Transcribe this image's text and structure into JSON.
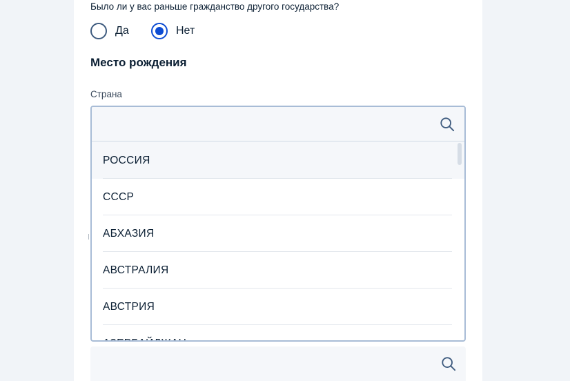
{
  "citizenship_question": {
    "text": "Было ли у вас раньше гражданство другого государства?",
    "options": [
      {
        "label": "Да",
        "selected": false
      },
      {
        "label": "Нет",
        "selected": true
      }
    ]
  },
  "birthplace": {
    "title": "Место рождения",
    "country_field": {
      "label": "Страна",
      "value": "",
      "placeholder": "",
      "search_icon": "search-icon",
      "options": [
        "РОССИЯ",
        "СССР",
        "АБХАЗИЯ",
        "АВСТРАЛИЯ",
        "АВСТРИЯ",
        "АЗЕРБАЙДЖАН"
      ],
      "highlighted_index": 0
    },
    "next_field": {
      "value": "",
      "search_icon": "search-icon"
    }
  },
  "colors": {
    "accent": "#0d4cd3",
    "text": "#0b1f33",
    "field_background": "#f5f7fa",
    "border": "#a8bcd6"
  }
}
